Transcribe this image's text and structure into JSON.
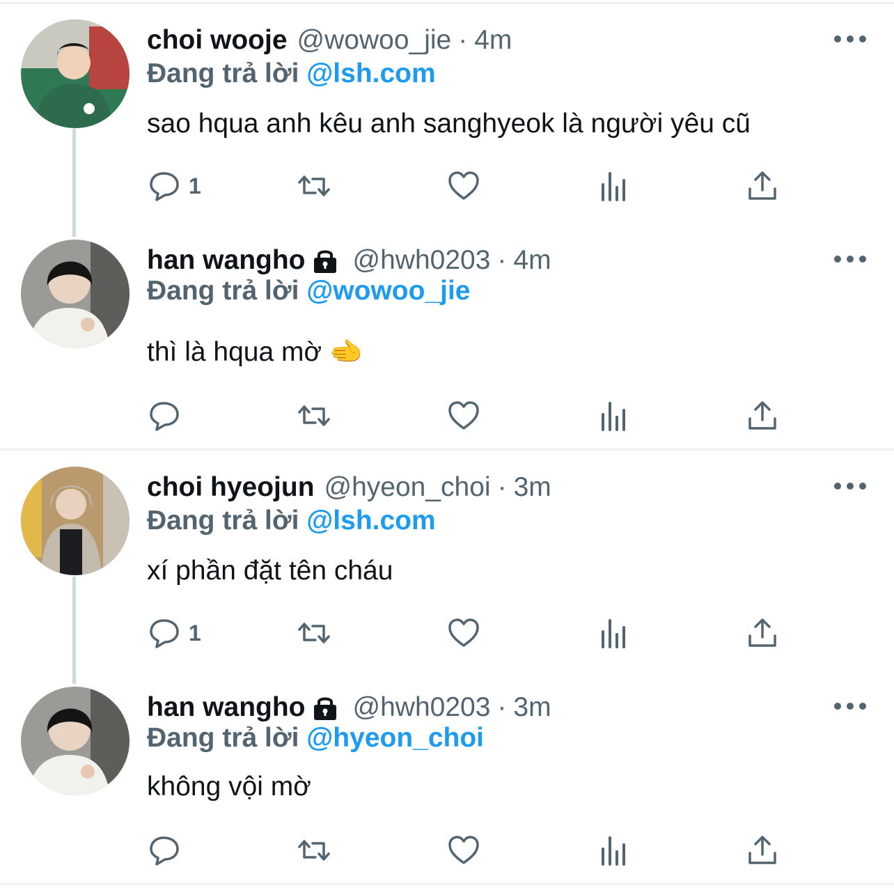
{
  "replying_prefix": "Đang trả lời",
  "colors": {
    "accent": "#1d9bf0",
    "muted": "#536471",
    "text": "#0f1419",
    "divider": "#eff3f4"
  },
  "icons": [
    "reply-icon",
    "retweet-icon",
    "like-icon",
    "views-icon",
    "share-icon",
    "more-icon",
    "lock-icon"
  ],
  "tweets": [
    {
      "name": "choi wooje",
      "protected": false,
      "handle": "@wowoo_jie",
      "time": "4m",
      "reply_to": "@lsh.com",
      "text": "sao hqua anh kêu anh sanghyeok là người yêu cũ",
      "reply_count": "1"
    },
    {
      "name": "han wangho",
      "protected": true,
      "handle": "@hwh0203",
      "time": "4m",
      "reply_to": "@wowoo_jie",
      "text": "thì là hqua mờ 🫲",
      "reply_count": ""
    },
    {
      "name": "choi hyeojun",
      "protected": false,
      "handle": "@hyeon_choi",
      "time": "3m",
      "reply_to": "@lsh.com",
      "text": "xí phần đặt tên cháu",
      "reply_count": "1"
    },
    {
      "name": "han wangho",
      "protected": true,
      "handle": "@hwh0203",
      "time": "3m",
      "reply_to": "@hyeon_choi",
      "text": "không vội mờ",
      "reply_count": ""
    }
  ]
}
